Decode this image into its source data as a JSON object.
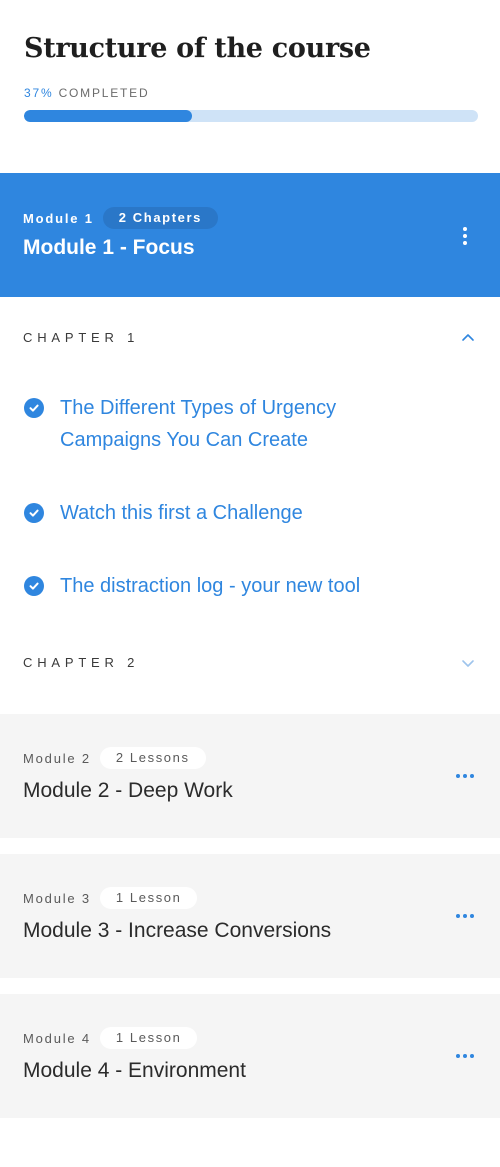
{
  "course": {
    "title": "Structure of the course",
    "progress_percent_text": "37%",
    "progress_suffix": "COMPLETED",
    "progress_value": 0.37
  },
  "modules": [
    {
      "number_label": "Module 1",
      "badge": "2 Chapters",
      "name": "Module 1 - Focus",
      "state": "expanded",
      "menu_icon": "kebab-vertical-icon",
      "chapters": [
        {
          "label": "CHAPTER 1",
          "expanded": true,
          "toggle_icon": "chevron-up-icon",
          "lessons": [
            {
              "title": "The Different Types of Urgency Campaigns You Can Create",
              "completed": true
            },
            {
              "title": "Watch this first a Challenge",
              "completed": true
            },
            {
              "title": "The distraction log - your new tool",
              "completed": true
            }
          ]
        },
        {
          "label": "CHAPTER 2",
          "expanded": false,
          "toggle_icon": "chevron-down-icon",
          "lessons": []
        }
      ]
    },
    {
      "number_label": "Module 2",
      "badge": "2 Lessons",
      "name": "Module 2 - Deep Work",
      "state": "collapsed",
      "menu_icon": "more-horizontal-icon"
    },
    {
      "number_label": "Module 3",
      "badge": "1 Lesson",
      "name": "Module 3 - Increase Conversions",
      "state": "collapsed",
      "menu_icon": "more-horizontal-icon"
    },
    {
      "number_label": "Module 4",
      "badge": "1 Lesson",
      "name": "Module 4 - Environment",
      "state": "collapsed",
      "menu_icon": "more-horizontal-icon"
    }
  ],
  "colors": {
    "accent": "#2f86df",
    "progress_track": "#cfe3f7",
    "collapsed_bg": "#f5f5f5",
    "badge_active_bg": "#2a77c8"
  }
}
